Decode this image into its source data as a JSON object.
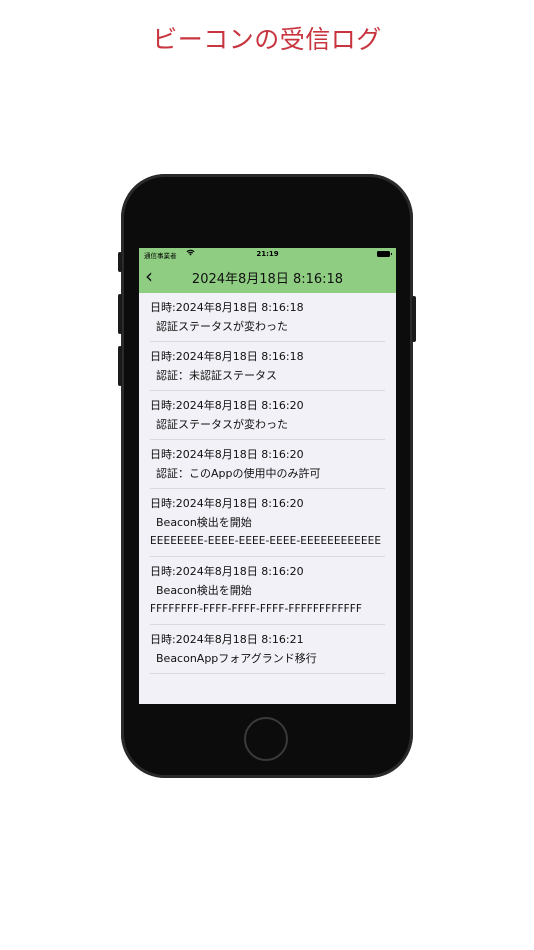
{
  "headline": "ビーコンの受信ログ",
  "status_bar": {
    "carrier": "通信事業者",
    "wifi_icon": "wifi-icon",
    "time": "21:19",
    "battery_icon": "battery-icon"
  },
  "nav": {
    "back_icon": "chevron-left-icon",
    "back_glyph": "‹",
    "title": "2024年8月18日 8:16:18"
  },
  "log": {
    "items": [
      {
        "date": "日時:2024年8月18日 8:16:18",
        "message": "認証ステータスが変わった"
      },
      {
        "date": "日時:2024年8月18日 8:16:18",
        "message": "認証：未認証ステータス"
      },
      {
        "date": "日時:2024年8月18日 8:16:20",
        "message": "認証ステータスが変わった"
      },
      {
        "date": "日時:2024年8月18日 8:16:20",
        "message": "認証：このAppの使用中のみ許可"
      },
      {
        "date": "日時:2024年8月18日 8:16:20",
        "message": "Beacon検出を開始",
        "uuid": "EEEEEEEE-EEEE-EEEE-EEEE-EEEEEEEEEEEE"
      },
      {
        "date": "日時:2024年8月18日 8:16:20",
        "message": "Beacon検出を開始",
        "uuid": "FFFFFFFF-FFFF-FFFF-FFFF-FFFFFFFFFFFF"
      },
      {
        "date": "日時:2024年8月18日 8:16:21",
        "message": "BeaconAppフォアグランド移行"
      }
    ]
  },
  "colors": {
    "headline": "#c8353f",
    "nav_bar": "#8fce82",
    "screen_bg": "#f2f1f7",
    "phone_body": "#0c0c0c"
  }
}
